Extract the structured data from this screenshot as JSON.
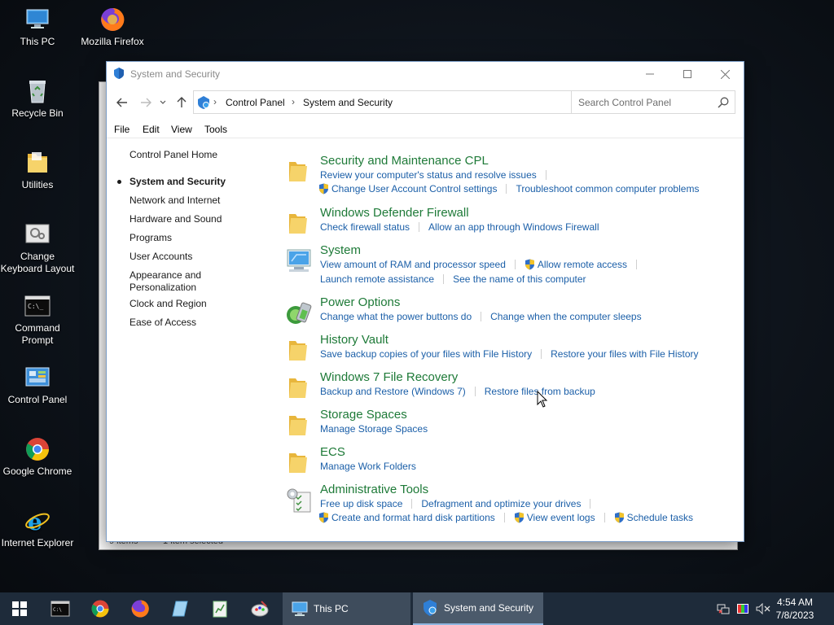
{
  "desktop": {
    "icons": [
      {
        "label": "This PC"
      },
      {
        "label": "Mozilla Firefox"
      },
      {
        "label": "Recycle Bin"
      },
      {
        "label": "Utilities"
      },
      {
        "label": "Change Keyboard Layout"
      },
      {
        "label": "Command Prompt"
      },
      {
        "label": "Control Panel"
      },
      {
        "label": "Google Chrome"
      },
      {
        "label": "Internet Explorer"
      }
    ]
  },
  "bg_window": {
    "status_items": "9 items",
    "status_selected": "1 item selected"
  },
  "window": {
    "title": "System and Security",
    "breadcrumb": [
      "Control Panel",
      "System and Security"
    ],
    "search_placeholder": "Search Control Panel",
    "menu": [
      "File",
      "Edit",
      "View",
      "Tools"
    ],
    "sidebar": {
      "home": "Control Panel Home",
      "items": [
        {
          "label": "System and Security",
          "current": true
        },
        {
          "label": "Network and Internet"
        },
        {
          "label": "Hardware and Sound"
        },
        {
          "label": "Programs"
        },
        {
          "label": "User Accounts"
        },
        {
          "label": "Appearance and Personalization"
        },
        {
          "label": "Clock and Region"
        },
        {
          "label": "Ease of Access"
        }
      ]
    },
    "categories": [
      {
        "title": "Security and Maintenance CPL",
        "icon": "folder-icon",
        "rows": [
          [
            "Review your computer's status and resolve issues"
          ],
          [
            "Change User Account Control settings",
            "Troubleshoot common computer problems"
          ]
        ]
      },
      {
        "title": "Windows Defender Firewall",
        "icon": "folder-icon",
        "rows": [
          [
            "Check firewall status",
            "Allow an app through Windows Firewall"
          ]
        ]
      },
      {
        "title": "System",
        "icon": "computer-icon",
        "rows": [
          [
            "View amount of RAM and processor speed",
            "Allow remote access"
          ],
          [
            "Launch remote assistance",
            "See the name of this computer"
          ]
        ]
      },
      {
        "title": "Power Options",
        "icon": "battery-icon",
        "rows": [
          [
            "Change what the power buttons do",
            "Change when the computer sleeps"
          ]
        ]
      },
      {
        "title": "History Vault",
        "icon": "folder-icon",
        "rows": [
          [
            "Save backup copies of your files with File History",
            "Restore your files with File History"
          ]
        ]
      },
      {
        "title": "Windows 7 File Recovery",
        "icon": "folder-icon",
        "rows": [
          [
            "Backup and Restore (Windows 7)",
            "Restore files from backup"
          ]
        ]
      },
      {
        "title": "Storage Spaces",
        "icon": "folder-icon",
        "rows": [
          [
            "Manage Storage Spaces"
          ]
        ]
      },
      {
        "title": "ECS",
        "icon": "folder-icon",
        "rows": [
          [
            "Manage Work Folders"
          ]
        ]
      },
      {
        "title": "Administrative Tools",
        "icon": "admin-tools-icon",
        "rows": [
          [
            "Free up disk space",
            "Defragment and optimize your drives"
          ],
          [
            "Create and format hard disk partitions",
            "View event logs",
            "Schedule tasks"
          ]
        ]
      }
    ]
  },
  "taskbar": {
    "tasks": [
      {
        "label": "This PC"
      },
      {
        "label": "System and Security"
      }
    ],
    "clock_time": "4:54 AM",
    "clock_date": "7/8/2023"
  },
  "colors": {
    "link": "#1b5fa8",
    "category_title": "#1e7a38",
    "taskbar": "#1e2b3a"
  }
}
